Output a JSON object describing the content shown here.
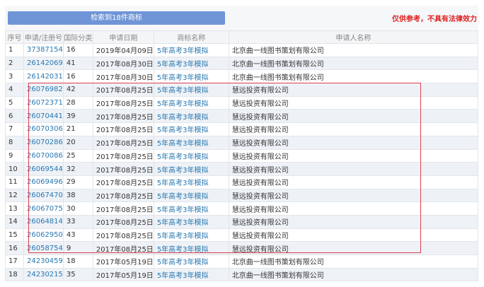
{
  "search_button": "检索到18件商标",
  "disclaimer": "仅供参考，不具有法律效力",
  "columns": [
    "序号",
    "申请/注册号",
    "国际分类",
    "申请日期",
    "商标名称",
    "申请人名称"
  ],
  "rows": [
    [
      "1",
      "37387154",
      "16",
      "2019年04月09日",
      "5年高考3年模拟",
      "北京曲一线图书策划有限公司"
    ],
    [
      "2",
      "26142069",
      "41",
      "2017年08月30日",
      "5年高考3年模拟",
      "北京曲一线图书策划有限公司"
    ],
    [
      "3",
      "26142031",
      "16",
      "2017年08月30日",
      "5年高考3年模拟",
      "北京曲一线图书策划有限公司"
    ],
    [
      "4",
      "26076982",
      "42",
      "2017年08月25日",
      "5年高考3年模拟",
      "慧远投资有限公司"
    ],
    [
      "5",
      "26072371",
      "28",
      "2017年08月25日",
      "5年高考3年模拟",
      "慧远投资有限公司"
    ],
    [
      "6",
      "26070441",
      "39",
      "2017年08月25日",
      "5年高考3年模拟",
      "慧远投资有限公司"
    ],
    [
      "7",
      "26070306",
      "21",
      "2017年08月25日",
      "5年高考3年模拟",
      "慧远投资有限公司"
    ],
    [
      "8",
      "26070286",
      "20",
      "2017年08月25日",
      "5年高考3年模拟",
      "慧远投资有限公司"
    ],
    [
      "9",
      "26070086",
      "25",
      "2017年08月25日",
      "5年高考3年模拟",
      "慧远投资有限公司"
    ],
    [
      "10",
      "26069544",
      "32",
      "2017年08月25日",
      "5年高考3年模拟",
      "慧远投资有限公司"
    ],
    [
      "11",
      "26069496",
      "29",
      "2017年08月25日",
      "5年高考3年模拟",
      "慧远投资有限公司"
    ],
    [
      "12",
      "26067470",
      "38",
      "2017年08月25日",
      "5年高考3年模拟",
      "慧远投资有限公司"
    ],
    [
      "13",
      "26067075",
      "30",
      "2017年08月25日",
      "5年高考3年模拟",
      "慧远投资有限公司"
    ],
    [
      "14",
      "26064814",
      "33",
      "2017年08月25日",
      "5年高考3年模拟",
      "慧远投资有限公司"
    ],
    [
      "15",
      "26062950",
      "43",
      "2017年08月25日",
      "5年高考3年模拟",
      "慧远投资有限公司"
    ],
    [
      "16",
      "26058754",
      "9",
      "2017年08月25日",
      "5年高考3年模拟",
      "慧远投资有限公司"
    ],
    [
      "17",
      "24230459",
      "18",
      "2017年05月19日",
      "5年高考3年模拟",
      "北京曲一线图书策划有限公司"
    ],
    [
      "18",
      "24230215",
      "35",
      "2017年05月19日",
      "5年高考3年模拟",
      "北京曲一线图书策划有限公司"
    ]
  ],
  "colors": {
    "button": "#6f95d6",
    "disclaimer": "#e02020",
    "link": "#2a78b0",
    "highlight_box": "#d9414f"
  }
}
